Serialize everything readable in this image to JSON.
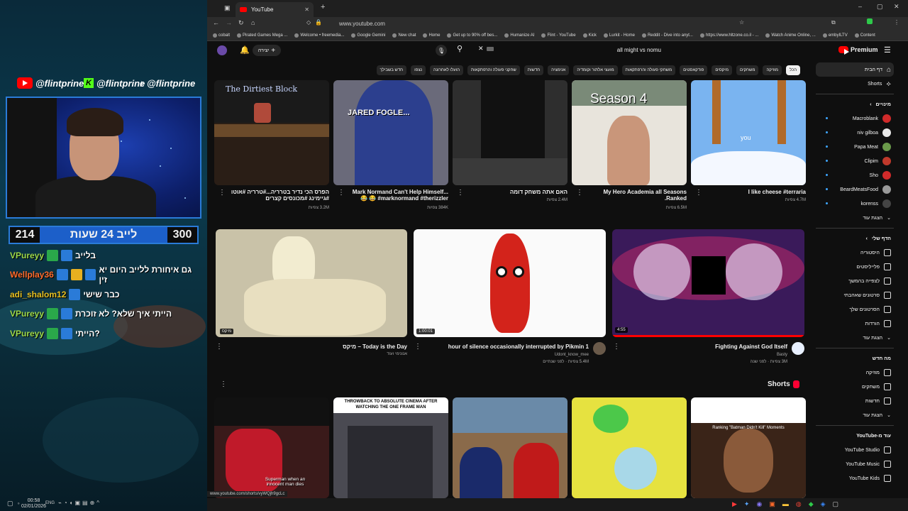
{
  "stream": {
    "social_handles": [
      "@flintprine",
      "@flintprine",
      "@flintprine"
    ],
    "counter_left": "214",
    "counter_title": "לייב 24 שעות",
    "counter_right": "300",
    "chat": [
      {
        "user": "VPureyy",
        "message": "בלייב"
      },
      {
        "user": "Wellplay36",
        "message": "גם איחורת ללייב היום יא זין"
      },
      {
        "user": "adi_shalom12",
        "message": "כבר שישי"
      },
      {
        "user": "VPureyy",
        "message": "הייתי איך שלא? לא זוכרת"
      },
      {
        "user": "VPureyy",
        "message": "הייתי?"
      }
    ],
    "clock": "00:58",
    "date": "02/01/2026",
    "lang": "ENG"
  },
  "browser": {
    "tab_title": "YouTube",
    "url": "www.youtube.com",
    "bookmarks": [
      "cobalt",
      "Pirated Games Mega ...",
      "Welcome • freemedia...",
      "Google Gemini",
      "New chat",
      "Home",
      "Get up to 90% off bes...",
      "Humanize AI",
      "Flint - YouTube",
      "Kick",
      "Lurkit - Home",
      "Reddit - Dive into anyt...",
      "https://www.hltzone.co.il - ...",
      "Watch Anime Online, ...",
      "embyILTV",
      "Content"
    ],
    "status_url": "www.youtube.com/shorts/vyWQjh9gcLc"
  },
  "youtube": {
    "search_value": "all might vs nomu",
    "create_label": "יצירה",
    "premium_label": "Premium",
    "chips": [
      "הכל",
      "מוזיקה",
      "משחקים",
      "מיקסים",
      "פודקאסטים",
      "משחקי פעולה והרפתקאות",
      "מועצי אלתור וקומדיה",
      "אנימציה",
      "חדשות",
      "שחקני פעולה והרפתקאות",
      "הועלו לאחרונה",
      "נצפו",
      "חדש בשבילך"
    ],
    "sidebar": {
      "home": "דף הבית",
      "shorts": "Shorts",
      "subs_header": "מינויים",
      "subs": [
        "Macroblank",
        "niv gilboa",
        "Papa Meat",
        "Clipim",
        "Sho",
        "BeardMeatsFood",
        "korenss"
      ],
      "show_more": "הצגת עוד",
      "you_header": "הדף שלי",
      "you_items": [
        "היסטוריה",
        "פלייליסטים",
        "לצפייה בהמשך",
        "סרטונים שאהבתי",
        "הסרטונים שלך",
        "הורדות"
      ],
      "show_more2": "הצגת עוד",
      "explore_header": "מה חדש",
      "explore_items": [
        "מוזיקה",
        "משחקים",
        "חדשות"
      ],
      "show_more3": "הצגת עוד",
      "more_header": "עוד מ-YouTube",
      "more_items": [
        "YouTube Studio",
        "YouTube Music",
        "YouTube Kids"
      ]
    },
    "row1": [
      {
        "title": "הפרס הכי נדיר בטרריה...#טרריה #אוטו #גיימינג #מכונסים קצרים",
        "meta": "3.2M צפיות",
        "thumb_text": "The Dirtiest Block"
      },
      {
        "title": "Mark Normand Can't Help Himself... 😂 😂 #marknormand #therizzler",
        "meta": "384K צפיות",
        "thumb_text": "JARED FOGLE..."
      },
      {
        "title": "האם אתה משחק דומה",
        "meta": "2.4M צפיות",
        "thumb_text": ""
      },
      {
        "title": "My Hero Academia all Seasons Ranked.",
        "meta": "6.5M צפיות",
        "thumb_text": "Season 4"
      },
      {
        "title": "I like cheese #terraria",
        "meta": "4.7M צפיות",
        "thumb_text": "you"
      }
    ],
    "row2": [
      {
        "title": "Today is the Day – מיקס",
        "channel": "אנונימי ועוד",
        "meta": "",
        "duration": "מיקס"
      },
      {
        "title": "1 hour of silence occasionally interrupted by Pikmin",
        "channel": "Udont_know_mee",
        "meta": "5.4M צפיות · לפני שנתיים",
        "duration": "1:00:01"
      },
      {
        "title": "Fighting Against God Itself",
        "channel": "Basty",
        "meta": "3M צפיות · לפני שנה",
        "duration": "4:55"
      }
    ],
    "shorts_label": "Shorts",
    "shorts": [
      {
        "thumb_text": "Superman when an innocent man dies"
      },
      {
        "thumb_text": "THROWBACK TO ABSOLUTE CINEMA AFTER WATCHING THE ONE FRAME MAN"
      },
      {
        "thumb_text": ""
      },
      {
        "thumb_text": ""
      },
      {
        "thumb_text": "Ranking \"Batman Didn't Kill\" Moments"
      }
    ]
  }
}
